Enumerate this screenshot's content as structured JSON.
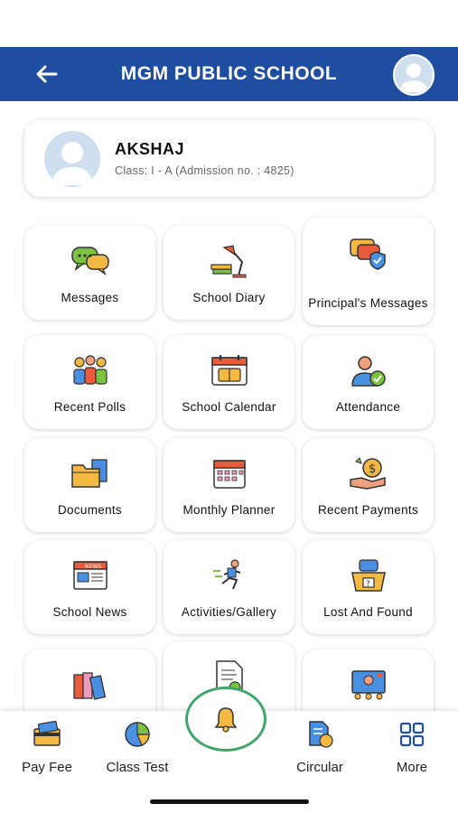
{
  "header": {
    "title": "MGM PUBLIC SCHOOL",
    "back_icon": "arrow-left-icon",
    "avatar_icon": "user-avatar-icon"
  },
  "student": {
    "name": "AKSHAJ",
    "class_info": "Class: I - A (Admission no. : 4825)"
  },
  "tiles": [
    {
      "label": "Messages",
      "icon": "chat-bubbles-icon"
    },
    {
      "label": "School Diary",
      "icon": "desk-lamp-icon"
    },
    {
      "label": "Principal's Messages",
      "icon": "shield-message-icon"
    },
    {
      "label": "Recent Polls",
      "icon": "group-poll-icon"
    },
    {
      "label": "School Calendar",
      "icon": "calendar-icon"
    },
    {
      "label": "Attendance",
      "icon": "attendance-icon"
    },
    {
      "label": "Documents",
      "icon": "folder-icon"
    },
    {
      "label": "Monthly Planner",
      "icon": "planner-icon"
    },
    {
      "label": "Recent Payments",
      "icon": "money-hand-icon"
    },
    {
      "label": "School News",
      "icon": "newspaper-icon"
    },
    {
      "label": "Activities/Gallery",
      "icon": "runner-icon"
    },
    {
      "label": "Lost And Found",
      "icon": "lost-box-icon"
    },
    {
      "label": "",
      "icon": "books-icon"
    },
    {
      "label": "",
      "icon": "report-icon"
    },
    {
      "label": "",
      "icon": "video-class-icon"
    }
  ],
  "bottom_nav": [
    {
      "label": "Pay Fee",
      "icon": "card-icon"
    },
    {
      "label": "Class Test",
      "icon": "pie-chart-icon"
    },
    {
      "label": "",
      "icon": "bell-icon"
    },
    {
      "label": "Circular",
      "icon": "circular-doc-icon"
    },
    {
      "label": "More",
      "icon": "grid-icon"
    }
  ],
  "colors": {
    "header": "#1f4ea1",
    "accent_green": "#3fa66a"
  }
}
